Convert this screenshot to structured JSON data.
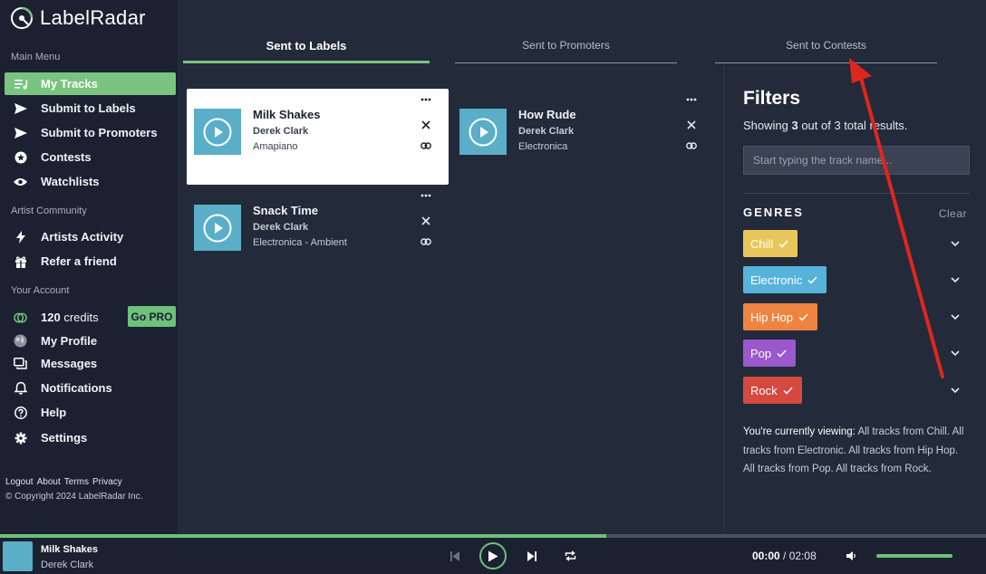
{
  "app": {
    "brand": "LabelRadar"
  },
  "sidebar": {
    "main_menu_title": "Main Menu",
    "main_items": [
      {
        "label": "My Tracks",
        "icon": "tracks-icon"
      },
      {
        "label": "Submit to Labels",
        "icon": "send-icon"
      },
      {
        "label": "Submit to Promoters",
        "icon": "send-icon"
      },
      {
        "label": "Contests",
        "icon": "star-icon"
      },
      {
        "label": "Watchlists",
        "icon": "eye-icon"
      }
    ],
    "community_title": "Artist Community",
    "community_items": [
      {
        "label": "Artists Activity",
        "icon": "bolt-icon"
      },
      {
        "label": "Refer a friend",
        "icon": "gift-icon"
      }
    ],
    "account_title": "Your Account",
    "credits": "120",
    "credits_suffix": "credits",
    "go_pro_label": "Go PRO",
    "account_items": [
      {
        "label": "My Profile",
        "icon": "globe-icon"
      },
      {
        "label": "Messages",
        "icon": "messages-icon"
      },
      {
        "label": "Notifications",
        "icon": "bell-icon"
      },
      {
        "label": "Help",
        "icon": "help-icon"
      },
      {
        "label": "Settings",
        "icon": "gear-icon"
      }
    ],
    "footer_links": [
      "Logout",
      "About",
      "Terms",
      "Privacy"
    ],
    "copyright": "© Copyright 2024 LabelRadar Inc."
  },
  "tabs": [
    {
      "label": "Sent to Labels",
      "active": true
    },
    {
      "label": "Sent to Promoters",
      "active": false
    },
    {
      "label": "Sent to Contests",
      "active": false
    }
  ],
  "tracks": [
    {
      "title": "Milk Shakes",
      "artist": "Derek Clark",
      "genre": "Amapiano",
      "selected": true
    },
    {
      "title": "How Rude",
      "artist": "Derek Clark",
      "genre": "Electronica",
      "selected": false
    },
    {
      "title": "Snack Time",
      "artist": "Derek Clark",
      "genre": "Electronica - Ambient",
      "selected": false
    }
  ],
  "filters": {
    "heading": "Filters",
    "showing_prefix": "Showing ",
    "showing_count": "3",
    "showing_suffix": " out of 3 total results.",
    "search_placeholder": "Start typing the track name...",
    "genres_heading": "GENRES",
    "clear_label": "Clear",
    "genres": [
      {
        "label": "Chill",
        "color": "#e8c75a"
      },
      {
        "label": "Electronic",
        "color": "#56b3d9"
      },
      {
        "label": "Hip Hop",
        "color": "#ee8440"
      },
      {
        "label": "Pop",
        "color": "#9a58cc"
      },
      {
        "label": "Rock",
        "color": "#d5493f"
      }
    ],
    "viewing_lead": "You're currently viewing:",
    "viewing_text": "All tracks from Chill. All tracks from Electronic. All tracks from Hip Hop. All tracks from Pop. All tracks from Rock."
  },
  "player": {
    "title": "Milk Shakes",
    "artist": "Derek Clark",
    "current_time": "00:00",
    "separator": "/",
    "total_time": "02:08",
    "progress": 0.615,
    "volume": 1.0
  },
  "colors": {
    "accent": "#7ac47f",
    "annotation_arrow": "#e0261c"
  }
}
